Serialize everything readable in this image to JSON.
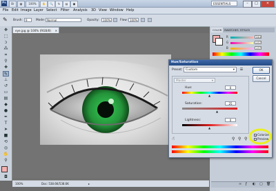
{
  "app": {
    "logo": "Ps",
    "zoom": "100%",
    "workspace": "ESSENTIALS"
  },
  "menu": [
    "File",
    "Edit",
    "Image",
    "Layer",
    "Select",
    "Filter",
    "Analysis",
    "3D",
    "View",
    "Window",
    "Help"
  ],
  "options": {
    "brush_label": "Brush:",
    "brush_size": "9",
    "mode_label": "Mode:",
    "mode_value": "Normal",
    "opacity_label": "Opacity:",
    "opacity_value": "100%",
    "flow_label": "Flow:",
    "flow_value": "100%"
  },
  "document": {
    "tab_label": "eye.jpg @ 100% (RGB/8)",
    "status_zoom": "100%",
    "status_doc": "Doc: 538.6K/538.6K"
  },
  "color_panel": {
    "tabs": [
      "COLOR",
      "SWATCHES",
      "STYLES"
    ],
    "r_label": "R",
    "g_label": "G",
    "b_label": "B",
    "r_value": "244",
    "g_value": "177",
    "b_value": "177"
  },
  "dialog": {
    "title": "Hue/Saturation",
    "preset_label": "Preset:",
    "preset_value": "Custom",
    "channel_value": "Master",
    "hue_label": "Hue:",
    "hue_value": "0",
    "saturation_label": "Saturation:",
    "saturation_value": "25",
    "lightness_label": "Lightness:",
    "lightness_value": "0",
    "ok_label": "OK",
    "cancel_label": "Cancel",
    "colorize_label": "Colorize",
    "preview_label": "Preview",
    "hand_glyph": "☝",
    "colorize_checked": true,
    "preview_checked": true
  },
  "colors": {
    "highlight": "#e9f01c",
    "iris": "#2a9a3c"
  }
}
